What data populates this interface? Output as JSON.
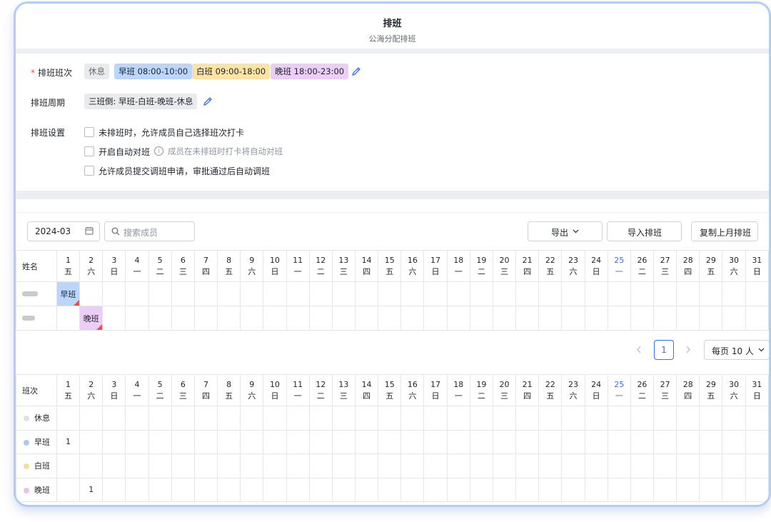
{
  "header": {
    "title": "排班",
    "subtitle": "公海分配排班"
  },
  "settings": {
    "shifts_label": "排班班次",
    "shifts": [
      {
        "label": "休息",
        "bg": "#e9eaec",
        "color": "#646a73"
      },
      {
        "label": "早班 08:00-10:00",
        "bg": "#bcd6fb",
        "color": "#1f2329"
      },
      {
        "label": "白班 09:00-18:00",
        "bg": "#fbe3a6",
        "color": "#1f2329"
      },
      {
        "label": "晚班 18:00-23:00",
        "bg": "#ebcdf6",
        "color": "#1f2329"
      }
    ],
    "cycle_label": "排班周期",
    "cycle_value": "三班倒: 早班-白班-晚班-休息",
    "options_label": "排班设置",
    "option1": "未排班时，允许成员自己选择班次打卡",
    "option2": "开启自动对班",
    "option2_hint": "成员在未排班时打卡将自动对班",
    "option3": "允许成员提交调班申请，审批通过后自动调班"
  },
  "toolbar": {
    "month": "2024-03",
    "search_placeholder": "搜索成员",
    "export": "导出",
    "import": "导入排班",
    "copy": "复制上月排班"
  },
  "calendar": {
    "today": 25,
    "days": [
      {
        "d": "1",
        "w": "五"
      },
      {
        "d": "2",
        "w": "六"
      },
      {
        "d": "3",
        "w": "日"
      },
      {
        "d": "4",
        "w": "一"
      },
      {
        "d": "5",
        "w": "二"
      },
      {
        "d": "6",
        "w": "三"
      },
      {
        "d": "7",
        "w": "四"
      },
      {
        "d": "8",
        "w": "五"
      },
      {
        "d": "9",
        "w": "六"
      },
      {
        "d": "10",
        "w": "日"
      },
      {
        "d": "11",
        "w": "一"
      },
      {
        "d": "12",
        "w": "二"
      },
      {
        "d": "13",
        "w": "三"
      },
      {
        "d": "14",
        "w": "四"
      },
      {
        "d": "15",
        "w": "五"
      },
      {
        "d": "16",
        "w": "六"
      },
      {
        "d": "17",
        "w": "日"
      },
      {
        "d": "18",
        "w": "一"
      },
      {
        "d": "19",
        "w": "二"
      },
      {
        "d": "20",
        "w": "三"
      },
      {
        "d": "21",
        "w": "四"
      },
      {
        "d": "22",
        "w": "五"
      },
      {
        "d": "23",
        "w": "六"
      },
      {
        "d": "24",
        "w": "日"
      },
      {
        "d": "25",
        "w": "一"
      },
      {
        "d": "26",
        "w": "二"
      },
      {
        "d": "27",
        "w": "三"
      },
      {
        "d": "28",
        "w": "四"
      },
      {
        "d": "29",
        "w": "五"
      },
      {
        "d": "30",
        "w": "六"
      },
      {
        "d": "31",
        "w": "日"
      }
    ]
  },
  "members_table": {
    "name_header": "姓名",
    "rows": [
      {
        "day": 1,
        "shift": "早班",
        "bg": "#bcd6fb"
      },
      {
        "day": 2,
        "shift": "晚班",
        "bg": "#ebcdf6"
      }
    ]
  },
  "pagination": {
    "page": "1",
    "page_size": "每页 10 人"
  },
  "shift_summary": {
    "header": "班次",
    "rows": [
      {
        "name": "休息",
        "color": "#e0e1e4",
        "counts": {}
      },
      {
        "name": "早班",
        "color": "#a9c9f7",
        "counts": {
          "1": "1"
        }
      },
      {
        "name": "白班",
        "color": "#f7dc96",
        "counts": {}
      },
      {
        "name": "晚班",
        "color": "#e4c1f2",
        "counts": {
          "2": "1"
        }
      }
    ]
  }
}
